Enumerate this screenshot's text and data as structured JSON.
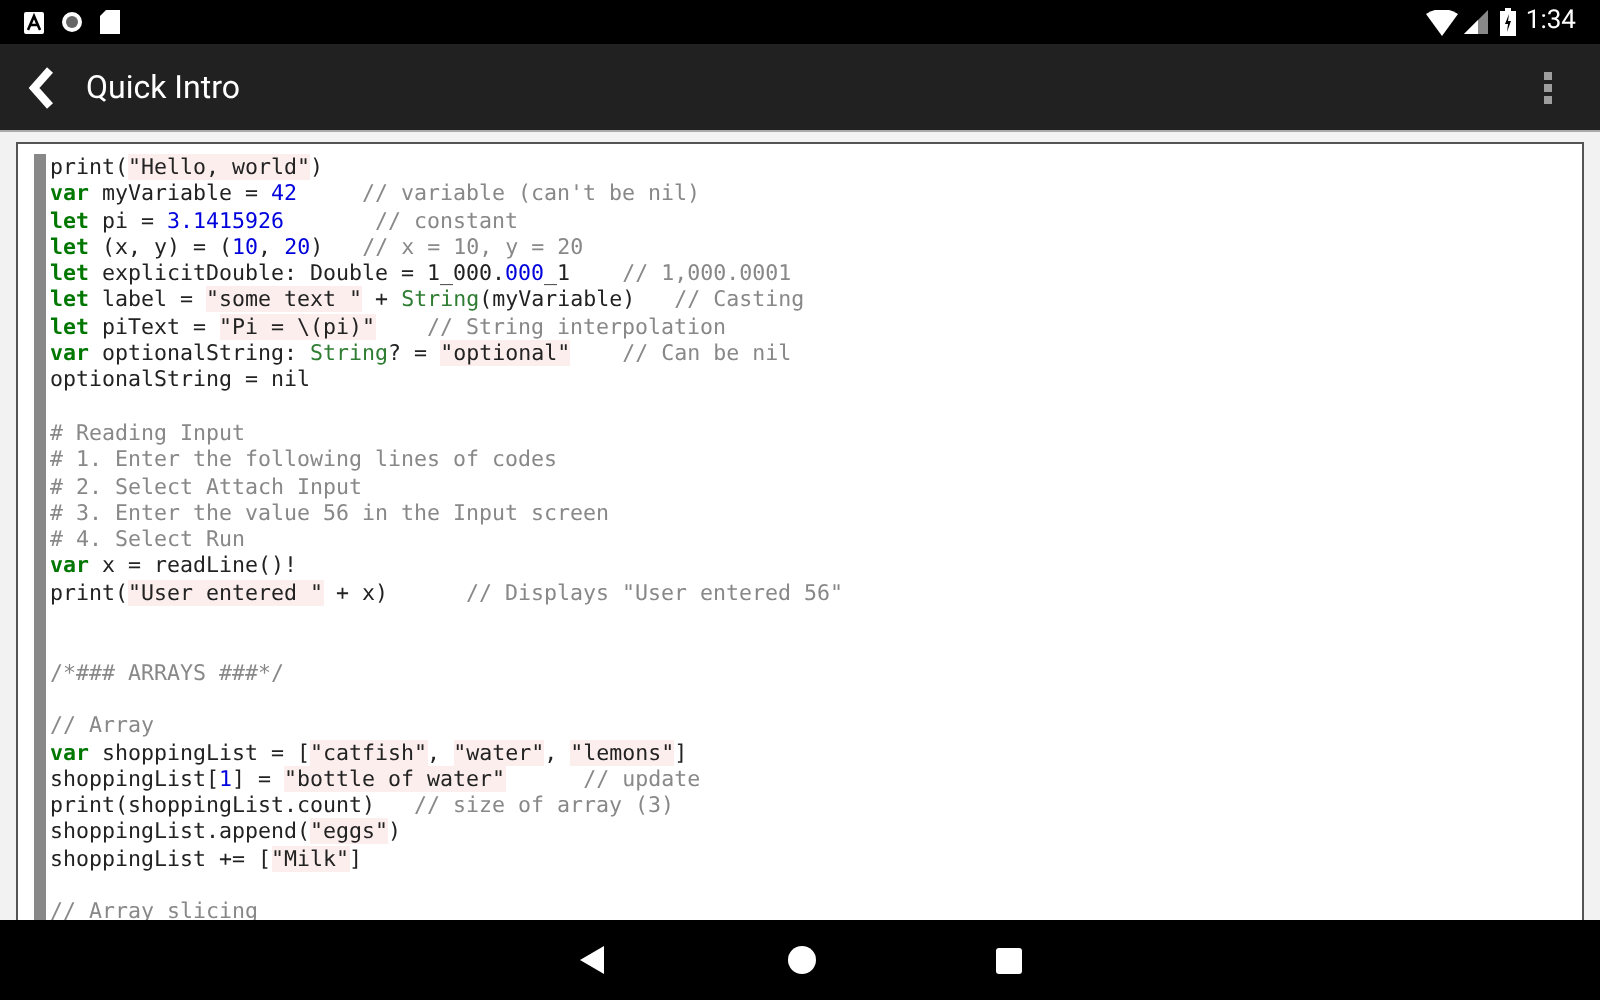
{
  "status_bar": {
    "time": "1:34"
  },
  "toolbar": {
    "title": "Quick Intro"
  },
  "code_lines": [
    {
      "kind": "code",
      "tokens": [
        {
          "kind": "plain",
          "text": "print("
        },
        {
          "kind": "string",
          "text": "\"Hello, world\""
        },
        {
          "kind": "plain",
          "text": ")"
        }
      ]
    },
    {
      "kind": "code",
      "tokens": [
        {
          "kind": "keyword",
          "text": "var"
        },
        {
          "kind": "plain",
          "text": " myVariable = "
        },
        {
          "kind": "number",
          "text": "42"
        },
        {
          "kind": "comment",
          "text": "     // variable (can't be nil)"
        }
      ]
    },
    {
      "kind": "code",
      "tokens": [
        {
          "kind": "keyword",
          "text": "let"
        },
        {
          "kind": "plain",
          "text": " pi = "
        },
        {
          "kind": "number",
          "text": "3.1415926"
        },
        {
          "kind": "comment",
          "text": "       // constant"
        }
      ]
    },
    {
      "kind": "code",
      "tokens": [
        {
          "kind": "keyword",
          "text": "let"
        },
        {
          "kind": "plain",
          "text": " (x, y) = ("
        },
        {
          "kind": "number",
          "text": "10"
        },
        {
          "kind": "plain",
          "text": ", "
        },
        {
          "kind": "number",
          "text": "20"
        },
        {
          "kind": "plain",
          "text": ")   "
        },
        {
          "kind": "comment",
          "text": "// x = 10, y = 20"
        }
      ]
    },
    {
      "kind": "code",
      "tokens": [
        {
          "kind": "keyword",
          "text": "let"
        },
        {
          "kind": "plain",
          "text": " explicitDouble: Double = 1_000."
        },
        {
          "kind": "number",
          "text": "000"
        },
        {
          "kind": "plain",
          "text": "_1    "
        },
        {
          "kind": "comment",
          "text": "// 1,000.0001"
        }
      ]
    },
    {
      "kind": "code",
      "tokens": [
        {
          "kind": "keyword",
          "text": "let"
        },
        {
          "kind": "plain",
          "text": " label = "
        },
        {
          "kind": "string",
          "text": "\"some text \""
        },
        {
          "kind": "plain",
          "text": " + "
        },
        {
          "kind": "type",
          "text": "String"
        },
        {
          "kind": "plain",
          "text": "(myVariable)   "
        },
        {
          "kind": "comment",
          "text": "// Casting"
        }
      ]
    },
    {
      "kind": "code",
      "tokens": [
        {
          "kind": "keyword",
          "text": "let"
        },
        {
          "kind": "plain",
          "text": " piText = "
        },
        {
          "kind": "string",
          "text": "\"Pi = \\(pi)\""
        },
        {
          "kind": "comment",
          "text": "    // String interpolation"
        }
      ]
    },
    {
      "kind": "code",
      "tokens": [
        {
          "kind": "keyword",
          "text": "var"
        },
        {
          "kind": "plain",
          "text": " optionalString: "
        },
        {
          "kind": "type",
          "text": "String"
        },
        {
          "kind": "plain",
          "text": "? = "
        },
        {
          "kind": "string",
          "text": "\"optional\""
        },
        {
          "kind": "comment",
          "text": "    // Can be nil"
        }
      ]
    },
    {
      "kind": "code",
      "tokens": [
        {
          "kind": "plain",
          "text": "optionalString = nil"
        }
      ]
    },
    {
      "kind": "blank"
    },
    {
      "kind": "code",
      "tokens": [
        {
          "kind": "comment",
          "text": "# Reading Input"
        }
      ]
    },
    {
      "kind": "code",
      "tokens": [
        {
          "kind": "comment",
          "text": "# 1. Enter the following lines of codes"
        }
      ]
    },
    {
      "kind": "code",
      "tokens": [
        {
          "kind": "comment",
          "text": "# 2. Select Attach Input"
        }
      ]
    },
    {
      "kind": "code",
      "tokens": [
        {
          "kind": "comment",
          "text": "# 3. Enter the value 56 in the Input screen"
        }
      ]
    },
    {
      "kind": "code",
      "tokens": [
        {
          "kind": "comment",
          "text": "# 4. Select Run"
        }
      ]
    },
    {
      "kind": "code",
      "tokens": [
        {
          "kind": "keyword",
          "text": "var"
        },
        {
          "kind": "plain",
          "text": " x = readLine()!"
        }
      ]
    },
    {
      "kind": "code",
      "tokens": [
        {
          "kind": "plain",
          "text": "print("
        },
        {
          "kind": "string",
          "text": "\"User entered \""
        },
        {
          "kind": "plain",
          "text": " + x)      "
        },
        {
          "kind": "comment",
          "text": "// Displays \"User entered 56\""
        }
      ]
    },
    {
      "kind": "blank"
    },
    {
      "kind": "blank"
    },
    {
      "kind": "code",
      "tokens": [
        {
          "kind": "comment",
          "text": "/*### ARRAYS ###*/"
        }
      ]
    },
    {
      "kind": "blank"
    },
    {
      "kind": "code",
      "tokens": [
        {
          "kind": "comment",
          "text": "// Array"
        }
      ]
    },
    {
      "kind": "code",
      "tokens": [
        {
          "kind": "keyword",
          "text": "var"
        },
        {
          "kind": "plain",
          "text": " shoppingList = ["
        },
        {
          "kind": "string",
          "text": "\"catfish\""
        },
        {
          "kind": "plain",
          "text": ", "
        },
        {
          "kind": "string",
          "text": "\"water\""
        },
        {
          "kind": "plain",
          "text": ", "
        },
        {
          "kind": "string",
          "text": "\"lemons\""
        },
        {
          "kind": "plain",
          "text": "]"
        }
      ]
    },
    {
      "kind": "code",
      "tokens": [
        {
          "kind": "plain",
          "text": "shoppingList["
        },
        {
          "kind": "number",
          "text": "1"
        },
        {
          "kind": "plain",
          "text": "] = "
        },
        {
          "kind": "string",
          "text": "\"bottle of water\""
        },
        {
          "kind": "comment",
          "text": "      // update"
        }
      ]
    },
    {
      "kind": "code",
      "tokens": [
        {
          "kind": "plain",
          "text": "print(shoppingList.count)   "
        },
        {
          "kind": "comment",
          "text": "// size of array (3)"
        }
      ]
    },
    {
      "kind": "code",
      "tokens": [
        {
          "kind": "plain",
          "text": "shoppingList.append("
        },
        {
          "kind": "string",
          "text": "\"eggs\""
        },
        {
          "kind": "plain",
          "text": ")"
        }
      ]
    },
    {
      "kind": "code",
      "tokens": [
        {
          "kind": "plain",
          "text": "shoppingList += ["
        },
        {
          "kind": "string",
          "text": "\"Milk\""
        },
        {
          "kind": "plain",
          "text": "]"
        }
      ]
    },
    {
      "kind": "blank"
    },
    {
      "kind": "code",
      "tokens": [
        {
          "kind": "comment",
          "text": "// Array slicing"
        }
      ]
    }
  ]
}
